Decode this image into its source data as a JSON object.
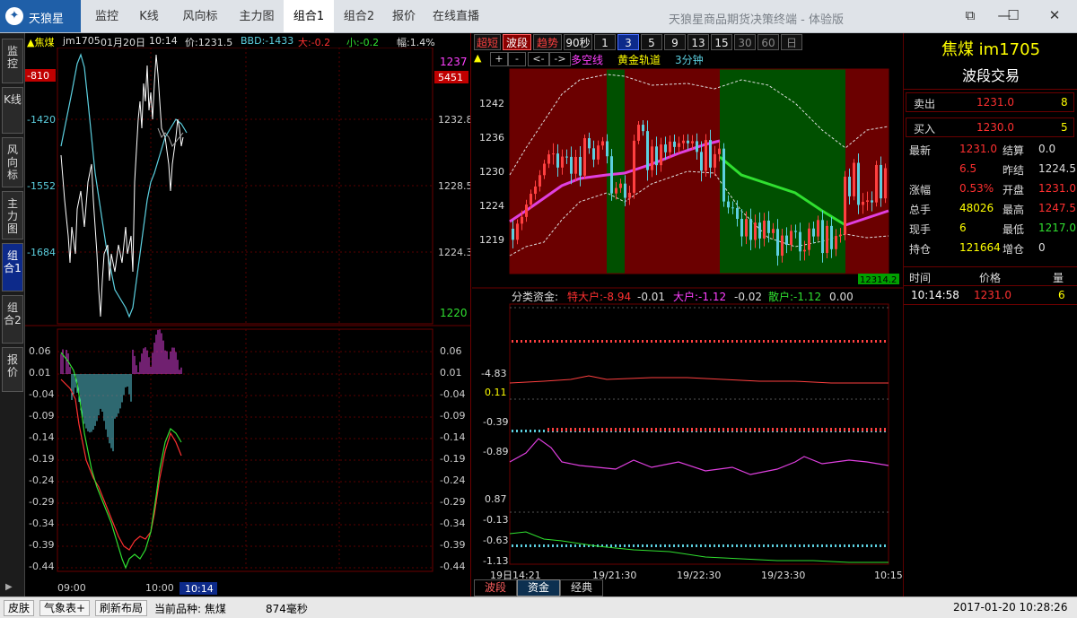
{
  "app": {
    "logo_text": "天狼星",
    "title": "天狼星商品期货决策终端 - 体验版",
    "tabs": [
      "监控",
      "K线",
      "风向标",
      "主力图",
      "组合1",
      "组合2",
      "报价",
      "在线直播"
    ],
    "active_tab": "组合1"
  },
  "vtabs": [
    {
      "label": "监控"
    },
    {
      "label": "K线"
    },
    {
      "label": "风向标"
    },
    {
      "label": "主力图"
    },
    {
      "label": "组合1"
    },
    {
      "label": "组合2"
    },
    {
      "label": "报价"
    }
  ],
  "left_header": {
    "symbol": "▲焦煤",
    "code": "jm1705",
    "date": "01月20日",
    "time": "10:14",
    "price": "价:1231.5",
    "bbd": "BBD:-1433",
    "big": "大:-0.2",
    "small": "小:-0.2",
    "amp": "幅:1.4%"
  },
  "left_upper": {
    "left_labels": [
      "-810",
      "-1420",
      "-1552",
      "-1684"
    ],
    "right_labels": [
      "1237",
      "5451",
      "1232.8",
      "1228.5",
      "1224.3",
      "1220"
    ]
  },
  "left_lower": {
    "labels": [
      "0.06",
      "0.01",
      "-0.04",
      "-0.09",
      "-0.14",
      "-0.19",
      "-0.24",
      "-0.29",
      "-0.34",
      "-0.39",
      "-0.44"
    ],
    "x_labels": [
      "09:00",
      "10:00"
    ],
    "cursor_time": "10:14"
  },
  "kline_toolbar": {
    "buttons": [
      "超短",
      "波段",
      "趋势",
      "90秒",
      "1",
      "3",
      "5",
      "9",
      "13",
      "15",
      "30",
      "60",
      "日"
    ],
    "active": "波段",
    "active_period": "3"
  },
  "kline_sub": {
    "arrow": "▲",
    "controls": [
      "+",
      "-",
      "<-",
      "->"
    ],
    "indicator": "多空线",
    "channel": "黄金轨道",
    "period": "3分钟"
  },
  "kline": {
    "y_labels": [
      "1242",
      "1236",
      "1230",
      "1224",
      "1219"
    ],
    "corner_value": "12314.2"
  },
  "fund": {
    "title": "分类资金:",
    "te": "特大户:-8.94",
    "te2": "-0.01",
    "da": "大户:-1.12",
    "da2": "-0.02",
    "san": "散户:-1.12",
    "san2": "0.00",
    "y_labels": [
      "-4.83",
      "0.11",
      "-0.39",
      "-0.89",
      "0.87",
      "-0.13",
      "-0.63",
      "-1.13"
    ],
    "x_labels": [
      "19日14:21",
      "19/21:30",
      "19/22:30",
      "19/23:30",
      "10:15"
    ]
  },
  "bottom_tabs": [
    "波段",
    "资金",
    "经典"
  ],
  "bottom_tab_active": "资金",
  "info": {
    "symbol": "焦煤 im1705",
    "subtitle": "波段交易",
    "sell": {
      "label": "卖出",
      "price": "1231.0",
      "vol": "8"
    },
    "buy": {
      "label": "买入",
      "price": "1230.0",
      "vol": "5"
    },
    "rows": [
      {
        "l1": "最新",
        "v1": "1231.0",
        "l2": "结算",
        "v2": "0.0"
      },
      {
        "l1": "",
        "v1": "6.5",
        "l2": "昨结",
        "v2": "1224.5"
      },
      {
        "l1": "涨幅",
        "v1": "0.53%",
        "l2": "开盘",
        "v2": "1231.0"
      },
      {
        "l1": "总手",
        "v1": "48026",
        "l2": "最高",
        "v2": "1247.5"
      },
      {
        "l1": "现手",
        "v1": "6",
        "l2": "最低",
        "v2": "1217.0"
      },
      {
        "l1": "持仓",
        "v1": "121664",
        "l2": "增仓",
        "v2": "0"
      }
    ],
    "trade_head": {
      "time": "时间",
      "price": "价格",
      "vol": "量"
    },
    "trade": {
      "time": "10:14:58",
      "price": "1231.0",
      "vol": "6"
    }
  },
  "status": {
    "skin": "皮肤",
    "weather": "气象表+",
    "refresh": "刷新布局",
    "current": "当前品种: 焦煤",
    "latency": "874毫秒",
    "datetime": "2017-01-20  10:28:26"
  },
  "colors": {
    "bg": "#000000",
    "red": "#ff3030",
    "cyan": "#5cd0e0",
    "magenta": "#ff40ff",
    "green": "#30e030",
    "yellow": "#ffff00",
    "maroon": "#6b0000",
    "darkgreen": "#005000"
  }
}
